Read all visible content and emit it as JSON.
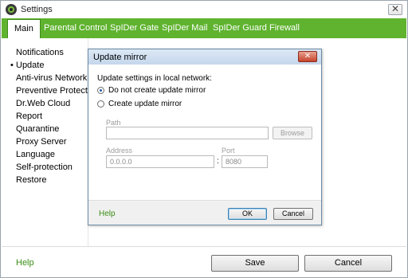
{
  "window": {
    "title": "Settings",
    "close_glyph": "✕"
  },
  "tabs": [
    {
      "label": "Main"
    },
    {
      "label": "Parental Control"
    },
    {
      "label": "SpIDer Gate"
    },
    {
      "label": "SpIDer Mail"
    },
    {
      "label": "SpIDer Guard"
    },
    {
      "label": "Firewall"
    }
  ],
  "sidebar": {
    "bullet": "•",
    "items": [
      {
        "label": "Notifications"
      },
      {
        "label": "Update"
      },
      {
        "label": "Anti-virus Network"
      },
      {
        "label": "Preventive Protection"
      },
      {
        "label": "Dr.Web Cloud"
      },
      {
        "label": "Report"
      },
      {
        "label": "Quarantine"
      },
      {
        "label": "Proxy Server"
      },
      {
        "label": "Language"
      },
      {
        "label": "Self-protection"
      },
      {
        "label": "Restore"
      }
    ]
  },
  "footer": {
    "help": "Help",
    "save": "Save",
    "cancel": "Cancel"
  },
  "dialog": {
    "title": "Update mirror",
    "close_glyph": "✕",
    "heading": "Update settings in local network:",
    "option_no_mirror": "Do not create update mirror",
    "option_create_mirror": "Create update mirror",
    "selected_option": "Do not create update mirror",
    "path_label": "Path",
    "path_value": "",
    "browse": "Browse",
    "address_label": "Address",
    "address_value": "0.0.0.0",
    "separator": ":",
    "port_label": "Port",
    "port_value": "8080",
    "help": "Help",
    "ok": "OK",
    "cancel": "Cancel"
  },
  "colors": {
    "accent_green": "#5fb32f",
    "help_green": "#3a8d14"
  },
  "icons": {
    "app": "drweb-spider-icon"
  }
}
